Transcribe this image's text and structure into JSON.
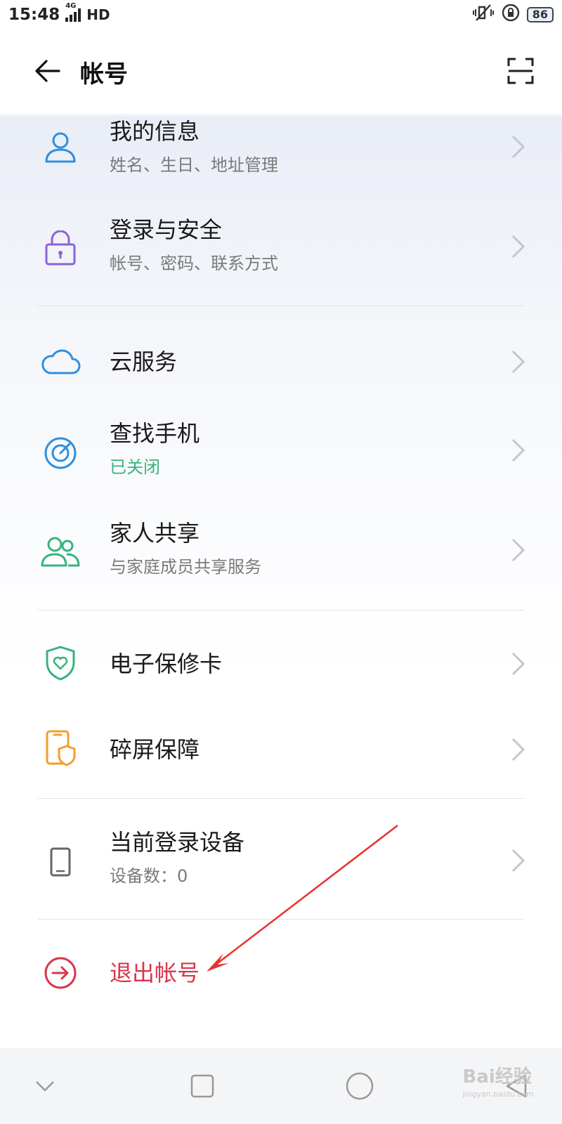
{
  "status_bar": {
    "time": "15:48",
    "network": "4G",
    "hd": "HD",
    "battery": "86"
  },
  "header": {
    "title": "帐号"
  },
  "items": [
    {
      "title": "我的信息",
      "subtitle": "姓名、生日、地址管理",
      "icon": "user-icon"
    },
    {
      "title": "登录与安全",
      "subtitle": "帐号、密码、联系方式",
      "icon": "lock-icon"
    },
    {
      "title": "云服务",
      "icon": "cloud-icon"
    },
    {
      "title": "查找手机",
      "subtitle": "已关闭",
      "icon": "radar-icon"
    },
    {
      "title": "家人共享",
      "subtitle": "与家庭成员共享服务",
      "icon": "family-icon"
    },
    {
      "title": "电子保修卡",
      "icon": "shield-heart-icon"
    },
    {
      "title": "碎屏保障",
      "icon": "phone-shield-icon"
    },
    {
      "title": "当前登录设备",
      "subtitle": "设备数：0",
      "icon": "device-icon"
    },
    {
      "title": "退出帐号",
      "icon": "logout-icon"
    }
  ],
  "watermark": {
    "text": "Bai经验",
    "url": "jingyan.baidu.com"
  },
  "colors": {
    "accent_blue": "#2e8fe0",
    "purple": "#8c62d9",
    "green": "#36b37e",
    "orange": "#f0a030",
    "red": "#d9354b"
  }
}
